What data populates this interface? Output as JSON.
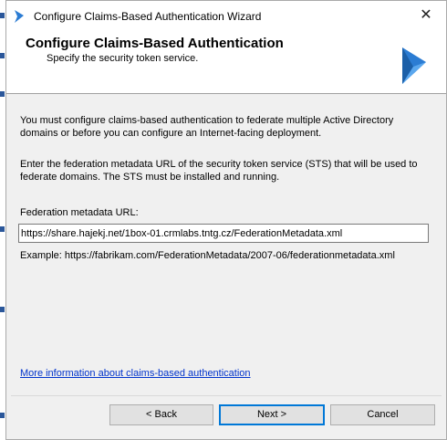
{
  "window": {
    "title": "Configure Claims-Based Authentication Wizard",
    "close_glyph": "✕"
  },
  "header": {
    "title": "Configure Claims-Based Authentication",
    "subtitle": "Specify the security token service.",
    "logo_icon": "dynamics-logo-icon"
  },
  "body": {
    "intro": "You must configure claims-based authentication to federate multiple Active Directory domains or before you can configure an Internet-facing deployment.",
    "instructions": "Enter the federation metadata URL of the security token service (STS) that will be used to federate domains. The STS must be installed and running.",
    "federation_label": "Federation metadata URL:",
    "federation_value": "https://share.hajekj.net/1box-01.crmlabs.tntg.cz/FederationMetadata.xml",
    "example": "Example: https://fabrikam.com/FederationMetadata/2007-06/federationmetadata.xml",
    "more_info_link": "More information about claims-based authentication"
  },
  "buttons": {
    "back": "< Back",
    "next": "Next >",
    "cancel": "Cancel"
  },
  "colors": {
    "accent": "#0078d7",
    "logo_blue": "#2b7cd3",
    "link": "#0033cc"
  }
}
